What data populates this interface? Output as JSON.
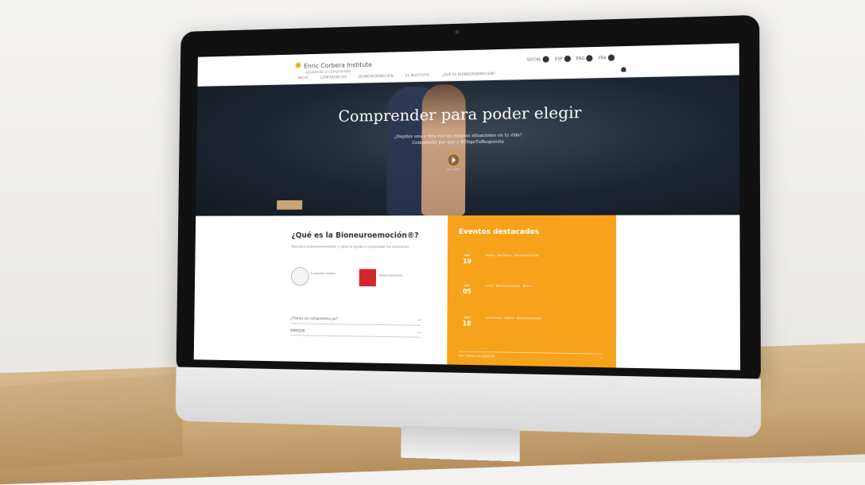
{
  "site": {
    "logo_name": "Enric Corbera Institute",
    "logo_tagline": "ayudando a comprender",
    "languages": [
      {
        "label": "SOCIAL"
      },
      {
        "label": "ESP"
      },
      {
        "label": "ENG"
      },
      {
        "label": "FRA"
      }
    ],
    "nav": [
      "INICIO",
      "CONFERENCIAS",
      "BIONEUROEMOCIÓN",
      "EL INSTITUTO",
      "¿QUÉ ES BIONEUROEMOCIÓN?"
    ]
  },
  "hero": {
    "title": "Comprender para poder elegir",
    "subtitle_line1": "¿Repites una y otra vez las mismas situaciones en tu vida?",
    "subtitle_line2": "Comprende por qué y #EligeTuRespuesta",
    "play_label": "Ver vídeo"
  },
  "about": {
    "heading": "¿Qué es la Bioneuroemoción®?",
    "text": "Descubre la bioneuroemoción y cómo te ayuda a comprender tus emociones.",
    "seal_label": "Fundación Corbera",
    "badge_label": "Bioneuroemoción",
    "question": "¿Tienes un compromiso ya?",
    "link": "EMPEZAR"
  },
  "events": {
    "heading": "Eventos destacados",
    "items": [
      {
        "day": "19",
        "month": "ENE",
        "text": "Evento · Barcelona · Bioneuroemoción"
      },
      {
        "day": "05",
        "month": "FEB",
        "text": "Curso · Bioneuroemoción · Nivel 1"
      },
      {
        "day": "18",
        "month": "MAR",
        "text": "Conferencia · Madrid · Bioneuroemoción"
      }
    ],
    "footer": "VER TODOS LOS EVENTOS"
  },
  "colors": {
    "accent": "#f6a21b",
    "hero_bg": "#1d2531"
  }
}
